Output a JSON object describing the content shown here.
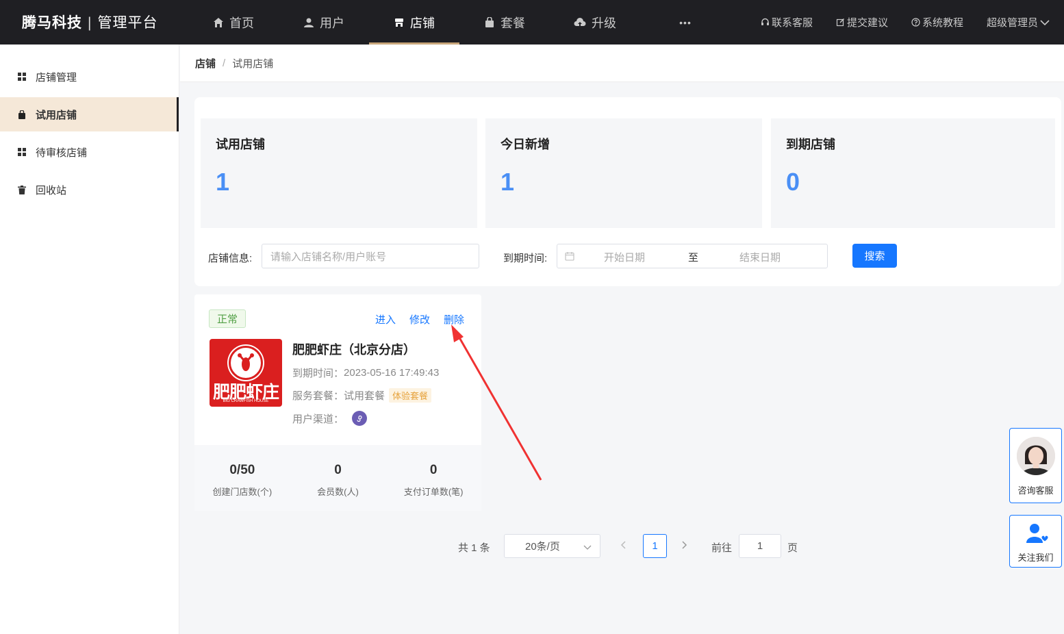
{
  "header": {
    "brand": "腾马科技",
    "separator": "|",
    "subtitle": "管理平台",
    "nav": [
      {
        "label": "首页",
        "icon": "home-icon"
      },
      {
        "label": "用户",
        "icon": "user-icon"
      },
      {
        "label": "店铺",
        "icon": "store-icon",
        "active": true
      },
      {
        "label": "套餐",
        "icon": "bag-icon"
      },
      {
        "label": "升级",
        "icon": "cloud-upload-icon"
      },
      {
        "label": "•••",
        "icon": "more-icon"
      }
    ],
    "right": {
      "support": "联系客服",
      "feedback": "提交建议",
      "tutorial": "系统教程",
      "user": "超级管理员"
    }
  },
  "sidebar": {
    "items": [
      {
        "label": "店铺管理"
      },
      {
        "label": "试用店铺",
        "active": true
      },
      {
        "label": "待审核店铺"
      },
      {
        "label": "回收站"
      }
    ]
  },
  "breadcrumb": {
    "root": "店铺",
    "separator": "/",
    "current": "试用店铺"
  },
  "stats": [
    {
      "label": "试用店铺",
      "value": "1"
    },
    {
      "label": "今日新增",
      "value": "1"
    },
    {
      "label": "到期店铺",
      "value": "0"
    }
  ],
  "filter": {
    "store_label": "店铺信息:",
    "store_placeholder": "请输入店铺名称/用户账号",
    "date_label": "到期时间:",
    "start_placeholder": "开始日期",
    "range_sep": "至",
    "end_placeholder": "结束日期",
    "search": "搜索"
  },
  "store": {
    "status": "正常",
    "actions": {
      "enter": "进入",
      "edit": "修改",
      "delete": "删除"
    },
    "logo_text": "肥肥虾庄",
    "logo_eng": "BIG CRAWFISH HOUSE",
    "name": "肥肥虾庄（北京分店）",
    "expire_label": "到期时间：",
    "expire_value": "2023-05-16 17:49:43",
    "package_label": "服务套餐：",
    "package_value": "试用套餐",
    "package_tag": "体验套餐",
    "channel_label": "用户渠道：",
    "stats": [
      {
        "value": "0/50",
        "label": "创建门店数(个)"
      },
      {
        "value": "0",
        "label": "会员数(人)"
      },
      {
        "value": "0",
        "label": "支付订单数(笔)"
      }
    ]
  },
  "pagination": {
    "total": "共 1 条",
    "page_size": "20条/页",
    "current": "1",
    "goto_label": "前往",
    "goto_value": "1",
    "page_suffix": "页"
  },
  "floating": {
    "consult": "咨询客服",
    "follow": "关注我们"
  },
  "colors": {
    "accent": "#1677ff",
    "header_bg": "#1f1f23",
    "active_nav_underline": "#c8a67a",
    "sidebar_active_bg": "#f5e8d8",
    "stat_number": "#4a8ff5",
    "annotation_arrow": "#f03232"
  }
}
